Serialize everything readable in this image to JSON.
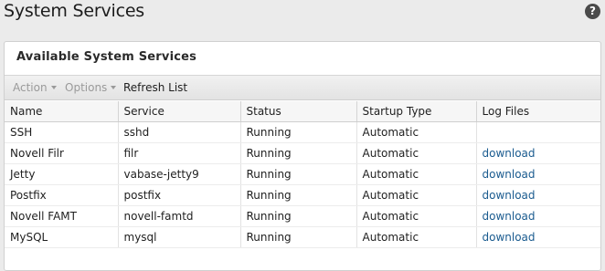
{
  "page": {
    "title": "System Services"
  },
  "help": {
    "glyph": "?"
  },
  "panel": {
    "title": "Available System Services"
  },
  "toolbar": {
    "action_label": "Action",
    "options_label": "Options",
    "refresh_label": "Refresh List"
  },
  "table": {
    "columns": [
      "Name",
      "Service",
      "Status",
      "Startup Type",
      "Log Files"
    ],
    "rows": [
      {
        "name": "SSH",
        "service": "sshd",
        "status": "Running",
        "startup": "Automatic",
        "log": ""
      },
      {
        "name": "Novell Filr",
        "service": "filr",
        "status": "Running",
        "startup": "Automatic",
        "log": "download"
      },
      {
        "name": "Jetty",
        "service": "vabase-jetty9",
        "status": "Running",
        "startup": "Automatic",
        "log": "download"
      },
      {
        "name": "Postfix",
        "service": "postfix",
        "status": "Running",
        "startup": "Automatic",
        "log": "download"
      },
      {
        "name": "Novell FAMT",
        "service": "novell-famtd",
        "status": "Running",
        "startup": "Automatic",
        "log": "download"
      },
      {
        "name": "MySQL",
        "service": "mysql",
        "status": "Running",
        "startup": "Automatic",
        "log": "download"
      }
    ]
  },
  "colors": {
    "link": "#1a5b8f",
    "disabled": "#9a9a9a",
    "background": "#ebebeb"
  }
}
